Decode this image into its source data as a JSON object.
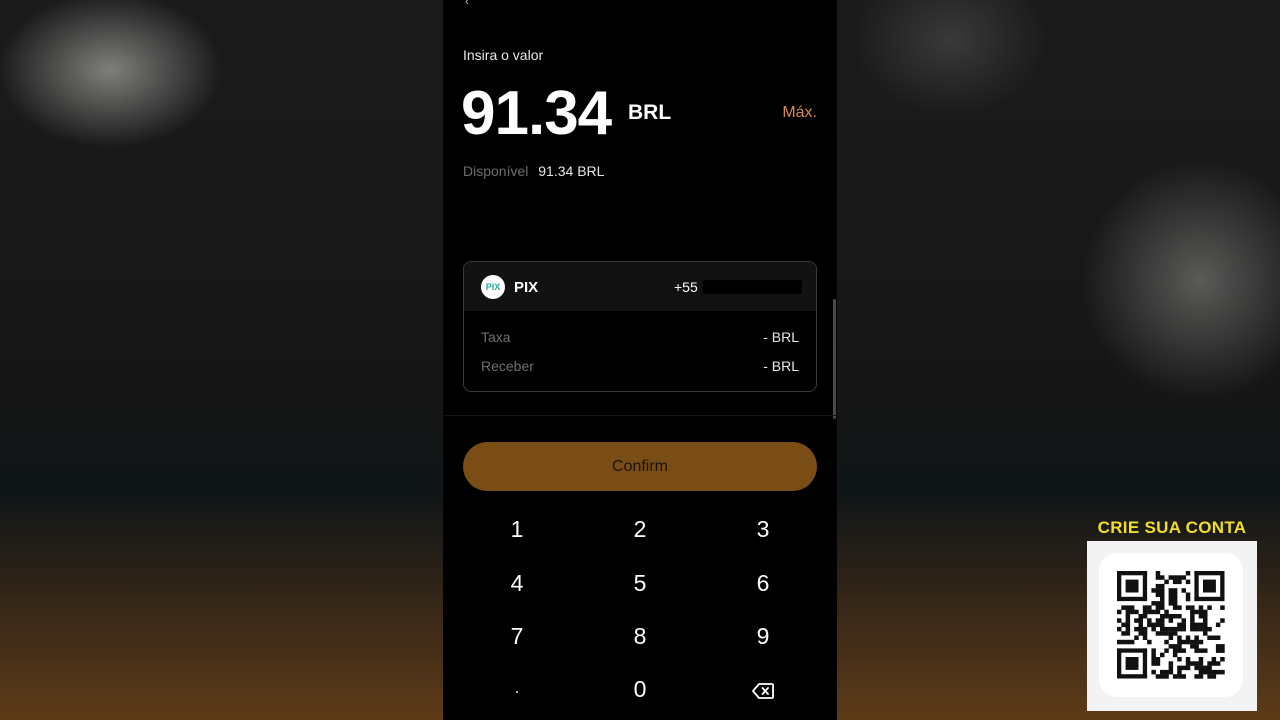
{
  "withdraw": {
    "prompt": "Insira o valor",
    "amount": "91.34",
    "currency": "BRL",
    "max_label": "Máx.",
    "available_label": "Disponível",
    "available_value": "91.34 BRL"
  },
  "payment_method": {
    "name": "PIX",
    "logo_text": "PIX",
    "phone_prefix": "+55",
    "rows": [
      {
        "label": "Taxa",
        "value": "- BRL"
      },
      {
        "label": "Receber",
        "value": "- BRL"
      }
    ]
  },
  "confirm_label": "Confirm",
  "keypad": [
    "1",
    "2",
    "3",
    "4",
    "5",
    "6",
    "7",
    "8",
    "9",
    ".",
    "0"
  ],
  "promo": {
    "title": "CRIE SUA CONTA"
  },
  "colors": {
    "accent": "#d98b4c",
    "confirm_bg": "#7a4d17",
    "promo_title": "#f2de2a"
  },
  "icons": {
    "backspace": "backspace-icon",
    "pix": "pix-logo-icon",
    "qr": "qr-code-icon"
  }
}
